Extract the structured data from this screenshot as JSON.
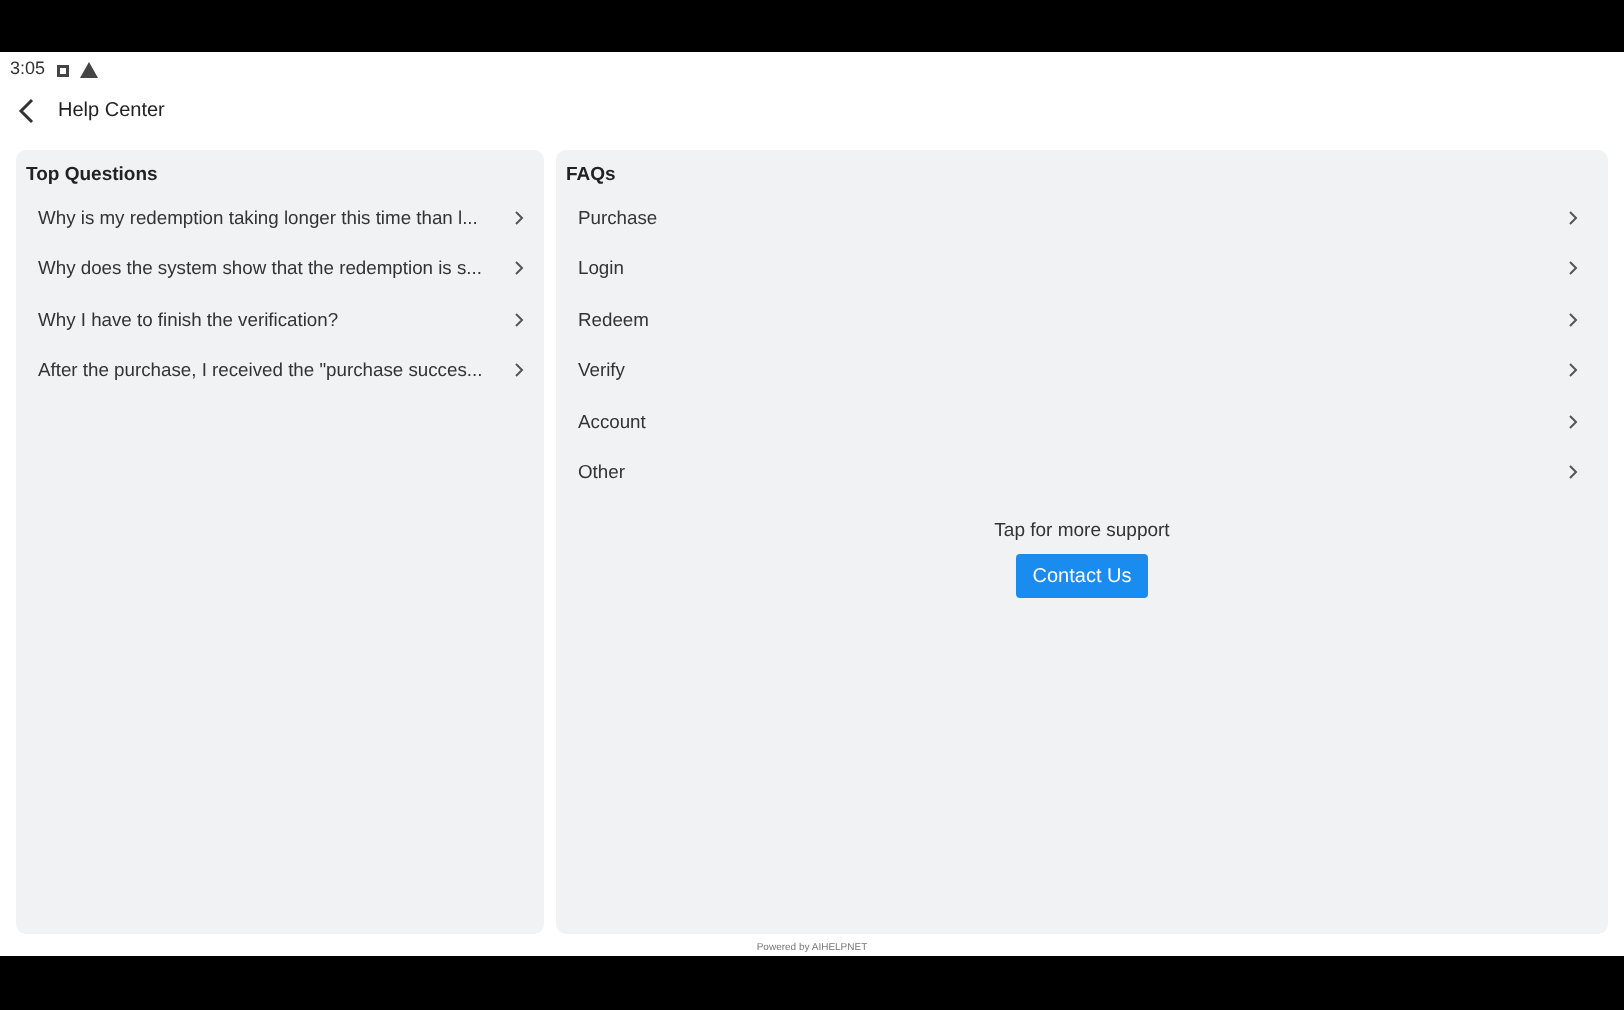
{
  "status_bar": {
    "time": "3:05"
  },
  "header": {
    "title": "Help Center"
  },
  "top_questions": {
    "title": "Top Questions",
    "items": [
      {
        "label": "Why is my redemption taking longer this time than l..."
      },
      {
        "label": "Why does the system show that the redemption is s..."
      },
      {
        "label": "Why I have to finish the verification?"
      },
      {
        "label": "After the purchase, I received the \"purchase succes..."
      }
    ]
  },
  "faqs": {
    "title": "FAQs",
    "items": [
      {
        "label": "Purchase"
      },
      {
        "label": "Login"
      },
      {
        "label": "Redeem"
      },
      {
        "label": "Verify"
      },
      {
        "label": "Account"
      },
      {
        "label": "Other"
      }
    ],
    "support_text": "Tap for more support",
    "contact_button": "Contact Us"
  },
  "footer": "Powered by AIHELPNET"
}
